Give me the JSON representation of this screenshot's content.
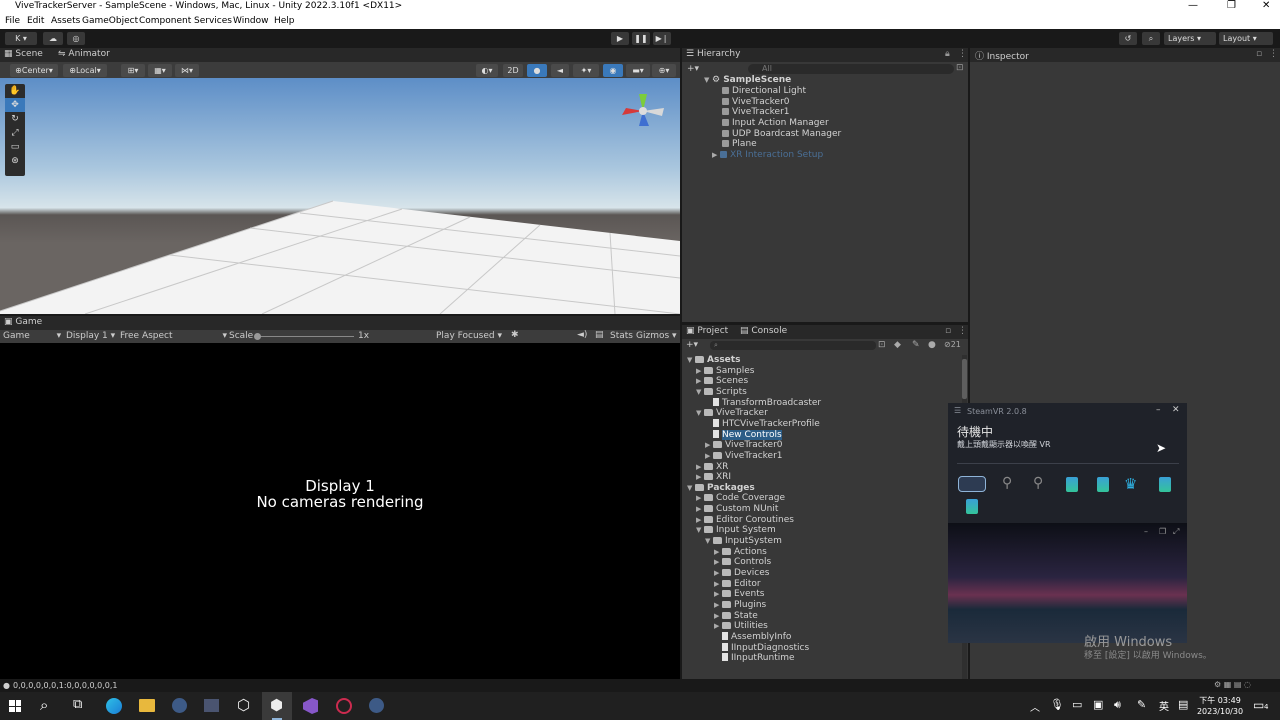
{
  "window": {
    "title": "ViveTrackerServer - SampleScene - Windows, Mac, Linux - Unity 2022.3.10f1 <DX11>",
    "min": "—",
    "max": "❐",
    "close": "✕"
  },
  "menu": [
    "File",
    "Edit",
    "Assets",
    "GameObject",
    "Component",
    "Services",
    "Window",
    "Help"
  ],
  "toolbar": {
    "account": "K ▾",
    "layers": "Layers",
    "layout": "Layout"
  },
  "scene": {
    "tab_scene": "Scene",
    "tab_animator": "Animator",
    "pivot": "Center",
    "space": "Local",
    "mode_2d": "2D"
  },
  "game": {
    "tab": "Game",
    "mode": "Game",
    "display": "Display 1",
    "aspect": "Free Aspect",
    "scale_label": "Scale",
    "scale_value": "1x",
    "play_focused": "Play Focused",
    "stats": "Stats",
    "gizmos": "Gizmos",
    "msg1": "Display 1",
    "msg2": "No cameras rendering"
  },
  "hierarchy": {
    "tab": "Hierarchy",
    "search": "All",
    "scene": "SampleScene",
    "items": [
      "Directional Light",
      "ViveTracker0",
      "ViveTracker1",
      "Input Action Manager",
      "UDP Boardcast Manager",
      "Plane",
      "XR Interaction Setup"
    ]
  },
  "inspector": {
    "tab": "Inspector"
  },
  "project": {
    "tab_project": "Project",
    "tab_console": "Console",
    "count": "21",
    "rows": [
      {
        "t": "Assets",
        "lvl": 0,
        "k": "open"
      },
      {
        "t": "Samples",
        "lvl": 1,
        "k": "fold"
      },
      {
        "t": "Scenes",
        "lvl": 1,
        "k": "fold"
      },
      {
        "t": "Scripts",
        "lvl": 1,
        "k": "open"
      },
      {
        "t": "TransformBroadcaster",
        "lvl": 2,
        "k": "file"
      },
      {
        "t": "ViveTracker",
        "lvl": 1,
        "k": "open"
      },
      {
        "t": "HTCViveTrackerProfile",
        "lvl": 2,
        "k": "file"
      },
      {
        "t": "New Controls",
        "lvl": 2,
        "k": "file",
        "sel": true
      },
      {
        "t": "ViveTracker0",
        "lvl": 2,
        "k": "fold"
      },
      {
        "t": "ViveTracker1",
        "lvl": 2,
        "k": "fold"
      },
      {
        "t": "XR",
        "lvl": 1,
        "k": "fold"
      },
      {
        "t": "XRI",
        "lvl": 1,
        "k": "fold"
      },
      {
        "t": "Packages",
        "lvl": 0,
        "k": "open"
      },
      {
        "t": "Code Coverage",
        "lvl": 1,
        "k": "fold"
      },
      {
        "t": "Custom NUnit",
        "lvl": 1,
        "k": "fold"
      },
      {
        "t": "Editor Coroutines",
        "lvl": 1,
        "k": "fold"
      },
      {
        "t": "Input System",
        "lvl": 1,
        "k": "open"
      },
      {
        "t": "InputSystem",
        "lvl": 2,
        "k": "open"
      },
      {
        "t": "Actions",
        "lvl": 3,
        "k": "fold"
      },
      {
        "t": "Controls",
        "lvl": 3,
        "k": "fold"
      },
      {
        "t": "Devices",
        "lvl": 3,
        "k": "fold"
      },
      {
        "t": "Editor",
        "lvl": 3,
        "k": "fold"
      },
      {
        "t": "Events",
        "lvl": 3,
        "k": "fold"
      },
      {
        "t": "Plugins",
        "lvl": 3,
        "k": "fold"
      },
      {
        "t": "State",
        "lvl": 3,
        "k": "fold"
      },
      {
        "t": "Utilities",
        "lvl": 3,
        "k": "fold"
      },
      {
        "t": "AssemblyInfo",
        "lvl": 3,
        "k": "file"
      },
      {
        "t": "IInputDiagnostics",
        "lvl": 3,
        "k": "file"
      },
      {
        "t": "IInputRuntime",
        "lvl": 3,
        "k": "file"
      }
    ]
  },
  "steamvr": {
    "title": "SteamVR 2.0.8",
    "status": "待機中",
    "sub": "戴上頭戴顯示器以喚醒 VR"
  },
  "watermark": {
    "l1": "啟用 Windows",
    "l2": "移至 [設定] 以啟用 Windows。"
  },
  "statusbar": {
    "text": "0,0,0,0,0,0,1:0,0,0,0,0,0,1"
  },
  "clock": {
    "time": "下午 03:49",
    "date": "2023/10/30",
    "ime": "英",
    "notif": "4"
  }
}
